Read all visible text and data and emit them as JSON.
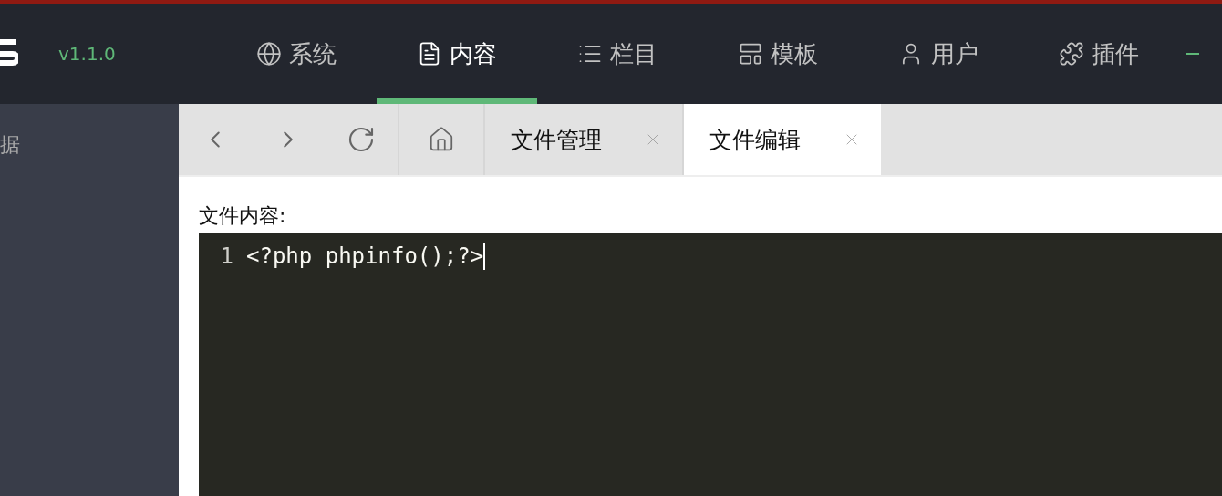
{
  "header": {
    "version": "v1.1.0",
    "nav": [
      {
        "kind": "globe",
        "label": "系统",
        "selected": false
      },
      {
        "kind": "file",
        "label": "内容",
        "selected": true
      },
      {
        "kind": "list",
        "label": "栏目",
        "selected": false
      },
      {
        "kind": "template",
        "label": "模板",
        "selected": false
      },
      {
        "kind": "user",
        "label": "用户",
        "selected": false
      },
      {
        "kind": "plugin",
        "label": "插件",
        "selected": false
      }
    ]
  },
  "sidebar": {
    "items": [
      {
        "label": "据"
      }
    ]
  },
  "tabs": [
    {
      "label": "文件管理",
      "selected": false
    },
    {
      "label": "文件编辑",
      "selected": true
    }
  ],
  "editor": {
    "label": "文件内容:",
    "lines": [
      {
        "number": "1",
        "code": "<?php phpinfo();?>"
      }
    ]
  }
}
